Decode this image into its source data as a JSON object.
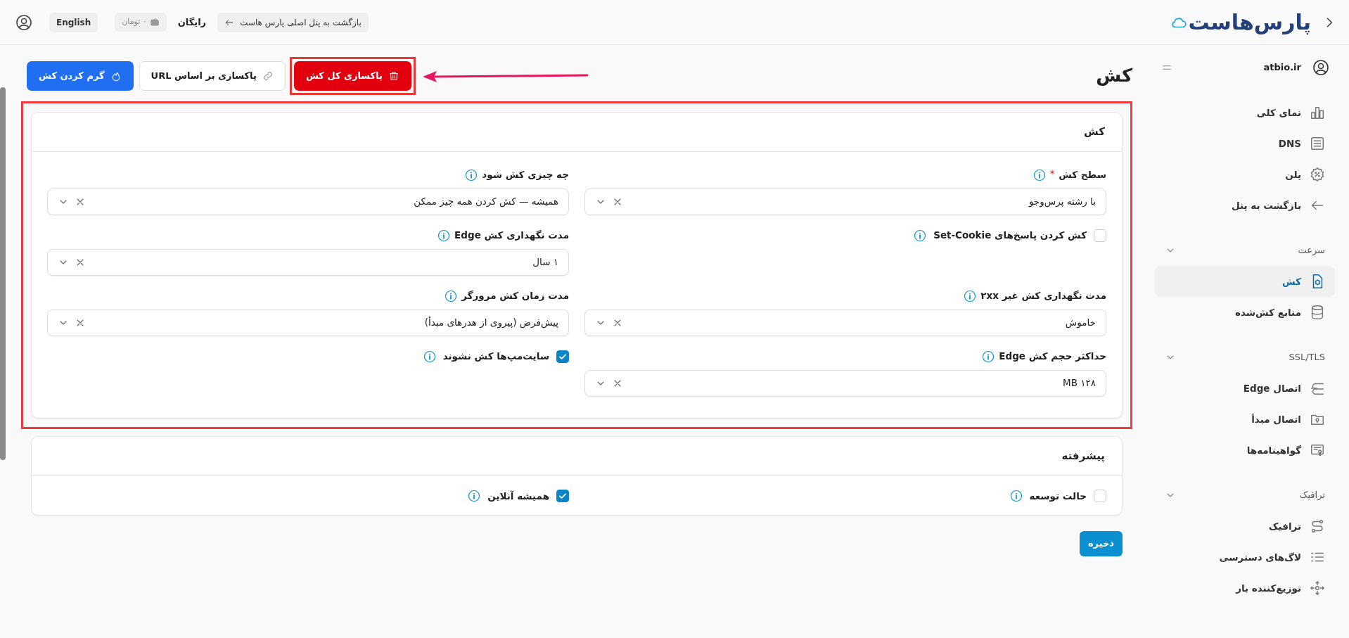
{
  "top_bar": {
    "logo": "پارس‌هاست",
    "back_link": "بازگشت به پنل اصلی پارس هاست",
    "plan": "رایگان",
    "balance": "۰ تومان",
    "language": "English"
  },
  "sidebar": {
    "account": "atbio.ir",
    "sections": [
      {
        "items": [
          {
            "label": "نمای کلی",
            "selected": false
          },
          {
            "label": "DNS",
            "selected": false
          },
          {
            "label": "پلن",
            "selected": false
          },
          {
            "label": "بازگشت به پنل",
            "selected": false
          }
        ]
      },
      {
        "title": "سرعت",
        "expanded": true,
        "items": [
          {
            "label": "کش",
            "selected": true
          },
          {
            "label": "منابع کش‌شده",
            "selected": false
          }
        ]
      },
      {
        "title": "SSL/TLS",
        "expanded": true,
        "items": [
          {
            "label": "اتصال Edge",
            "selected": false
          },
          {
            "label": "اتصال مبدأ",
            "selected": false
          },
          {
            "label": "گواهینامه‌ها",
            "selected": false
          }
        ]
      },
      {
        "title": "ترافیک",
        "expanded": true,
        "items": [
          {
            "label": "ترافیک",
            "selected": false
          },
          {
            "label": "لاگ‌های دسترسی",
            "selected": false
          },
          {
            "label": "توزیع‌کننده بار",
            "selected": false
          }
        ]
      }
    ]
  },
  "page": {
    "title": "کش",
    "actions": [
      {
        "kind": "danger",
        "label": "پاکسازی کل کش"
      },
      {
        "kind": "outline",
        "label": "پاکسازی بر اساس URL"
      },
      {
        "kind": "primary",
        "label": "گرم کردن کش"
      }
    ]
  },
  "cache_card": {
    "title": "کش",
    "fields": [
      {
        "kind": "select",
        "label": "سطح کش",
        "required_mark": "*",
        "value": "با رشته پرس‌وجو"
      },
      {
        "kind": "select",
        "label": "چه چیزی کش شود",
        "value": "همیشه — کش کردن همه چیز ممکن"
      },
      {
        "kind": "checkbox",
        "label": "کش کردن پاسخ‌های Set-Cookie",
        "checked": false
      },
      {
        "kind": "select",
        "label": "مدت نگهداری کش Edge",
        "value": "۱ سال"
      },
      {
        "kind": "select",
        "label": "مدت نگهداری کش غیر ۲xx",
        "value": "خاموش"
      },
      {
        "kind": "select",
        "label": "مدت زمان کش مرورگر",
        "value": "پیش‌فرض (پیروی از هدرهای مبدأ)"
      },
      {
        "kind": "select",
        "label": "حداکثر حجم کش Edge",
        "value": "۱۲۸ MB"
      },
      {
        "kind": "checkbox",
        "label": "سایت‌مپ‌ها کش نشوند",
        "checked": true
      }
    ]
  },
  "advanced_card": {
    "title": "پیشرفته",
    "fields": [
      {
        "kind": "checkbox",
        "label": "حالت توسعه",
        "checked": false
      },
      {
        "kind": "checkbox",
        "label": "همیشه آنلاین",
        "checked": true
      }
    ]
  },
  "save_button": "ذخیره"
}
